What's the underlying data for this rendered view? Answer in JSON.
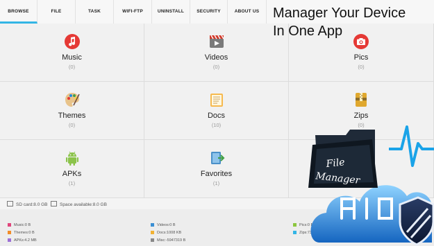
{
  "tabs": [
    "BROWSE",
    "FILE",
    "TASK",
    "WIFI-FTP",
    "UNINSTALL",
    "SECURITY",
    "ABOUT US"
  ],
  "promo": {
    "line1": "Manager Your Device",
    "line2": "In One App"
  },
  "categories": [
    {
      "label": "Music",
      "count": "(0)",
      "icon": "music-icon"
    },
    {
      "label": "Videos",
      "count": "(0)",
      "icon": "videos-icon"
    },
    {
      "label": "Pics",
      "count": "(0)",
      "icon": "camera-icon"
    },
    {
      "label": "Themes",
      "count": "(0)",
      "icon": "palette-icon"
    },
    {
      "label": "Docs",
      "count": "(10)",
      "icon": "docs-icon"
    },
    {
      "label": "Zips",
      "count": "(0)",
      "icon": "zip-icon"
    },
    {
      "label": "APKs",
      "count": "(1)",
      "icon": "android-icon"
    },
    {
      "label": "Favorites",
      "count": "(1)",
      "icon": "favorites-icon"
    }
  ],
  "storage": {
    "sd_card": "SD card:8.0 GB",
    "space_available": "Space available:8.0 GB"
  },
  "legend": [
    {
      "text": "Music:0 B",
      "color": "#e0457b"
    },
    {
      "text": "Videos:0 B",
      "color": "#3b8fd4"
    },
    {
      "text": "Pics:0 B",
      "color": "#8cc63e"
    },
    {
      "text": "Themes:0 B",
      "color": "#f28c28"
    },
    {
      "text": "Docs:1008 KB",
      "color": "#f2b233"
    },
    {
      "text": "Zips:733 KB",
      "color": "#33b5e5"
    },
    {
      "text": "APKs:4.2 MB",
      "color": "#9c6fd6"
    },
    {
      "text": "Misc:-5947319 B",
      "color": "#888888"
    }
  ],
  "logo": {
    "line1": "File",
    "line2": "Manager",
    "accent": "#1aa3e8"
  }
}
